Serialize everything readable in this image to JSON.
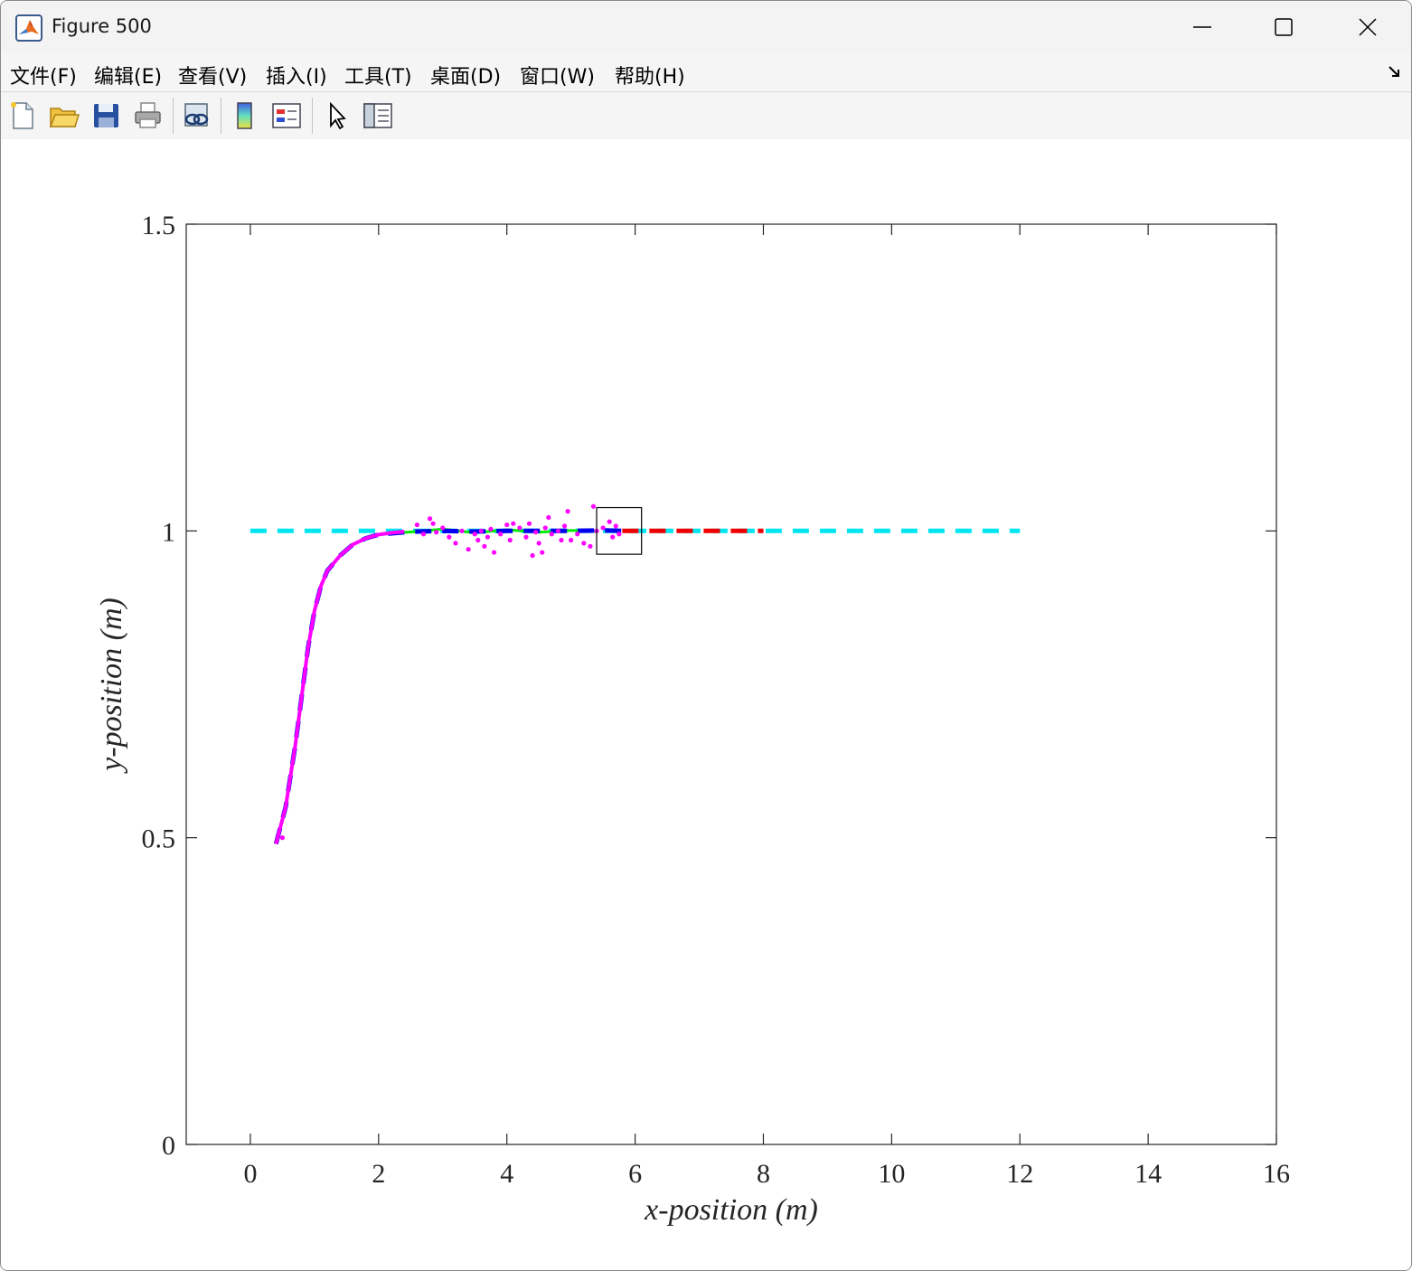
{
  "window": {
    "title": "Figure 500",
    "controls": {
      "minimize": "minimize",
      "maximize": "maximize",
      "close": "close"
    }
  },
  "menu": {
    "items": [
      {
        "label": "文件(F)",
        "id": "file"
      },
      {
        "label": "编辑(E)",
        "id": "edit"
      },
      {
        "label": "查看(V)",
        "id": "view"
      },
      {
        "label": "插入(I)",
        "id": "insert"
      },
      {
        "label": "工具(T)",
        "id": "tools"
      },
      {
        "label": "桌面(D)",
        "id": "desktop"
      },
      {
        "label": "窗口(W)",
        "id": "window"
      },
      {
        "label": "帮助(H)",
        "id": "help"
      }
    ]
  },
  "toolbar": {
    "buttons": [
      "new-figure-icon",
      "open-file-icon",
      "save-icon",
      "print-icon",
      "link-plot-icon",
      "colorbar-icon",
      "legend-icon",
      "edit-plot-arrow-icon",
      "property-inspector-icon"
    ]
  },
  "chart_data": {
    "type": "line",
    "title": "",
    "xlabel": "x-position (m)",
    "ylabel": "y-position (m)",
    "xlim": [
      -1,
      16
    ],
    "ylim": [
      0,
      1.5
    ],
    "xticks": [
      "0",
      "2",
      "4",
      "6",
      "8",
      "10",
      "12",
      "14",
      "16"
    ],
    "yticks": [
      "0",
      "0.5",
      "1",
      "1.5"
    ],
    "grid": false,
    "legend": "none",
    "series": [
      {
        "style": "dashed",
        "color": "#00e5f0",
        "x": [
          0,
          12
        ],
        "y": [
          1,
          1
        ]
      },
      {
        "style": "solid",
        "color": "#00ee00",
        "x": [
          0.4,
          0.55,
          0.7,
          0.8,
          0.9,
          1.0,
          1.1,
          1.2,
          1.4,
          1.6,
          1.8,
          2.0,
          2.3,
          2.6,
          3.0,
          3.5,
          4.0,
          4.5,
          5.0,
          5.4
        ],
        "y": [
          0.49,
          0.55,
          0.65,
          0.73,
          0.81,
          0.87,
          0.91,
          0.935,
          0.96,
          0.978,
          0.988,
          0.994,
          0.997,
          0.999,
          1.003,
          0.997,
          1.002,
          0.998,
          1.001,
          0.999
        ]
      },
      {
        "style": "dashed",
        "color": "#0000ee",
        "x": [
          0.4,
          0.55,
          0.7,
          0.8,
          0.9,
          1.0,
          1.1,
          1.2,
          1.4,
          1.6,
          1.8,
          2.0,
          2.3,
          2.6,
          3.0,
          3.5,
          4.0,
          4.5,
          5.0,
          5.5,
          5.8
        ],
        "y": [
          0.49,
          0.55,
          0.65,
          0.73,
          0.81,
          0.87,
          0.91,
          0.935,
          0.96,
          0.978,
          0.988,
          0.994,
          0.997,
          0.999,
          1.0,
          0.999,
          1.0,
          1.0,
          1.0,
          1.001,
          1.0
        ]
      },
      {
        "style": "dashed",
        "color": "#ee0000",
        "x": [
          5.8,
          8.0
        ],
        "y": [
          1,
          1
        ]
      },
      {
        "style": "solid",
        "color": "#ff00ff",
        "x": [
          0.4,
          0.55,
          0.7,
          0.8,
          0.9,
          1.0,
          1.1,
          1.2,
          1.4,
          1.6,
          1.8,
          2.0,
          2.2,
          2.4
        ],
        "y": [
          0.49,
          0.55,
          0.65,
          0.73,
          0.81,
          0.87,
          0.91,
          0.935,
          0.96,
          0.978,
          0.988,
          0.994,
          0.997,
          0.999
        ]
      },
      {
        "style": "markers",
        "color": "#ff00ff",
        "x": [
          0.5,
          2.6,
          2.7,
          2.8,
          2.85,
          2.9,
          3.0,
          3.1,
          3.2,
          3.3,
          3.4,
          3.5,
          3.55,
          3.6,
          3.65,
          3.7,
          3.75,
          3.8,
          3.9,
          4.0,
          4.05,
          4.1,
          4.2,
          4.3,
          4.35,
          4.4,
          4.45,
          4.5,
          4.55,
          4.6,
          4.65,
          4.7,
          4.8,
          4.85,
          4.9,
          4.95,
          5.0,
          5.1,
          5.2,
          5.3,
          5.35,
          5.4,
          5.5,
          5.6,
          5.65,
          5.7,
          5.75
        ],
        "y": [
          0.5,
          1.01,
          0.995,
          1.02,
          1.012,
          0.998,
          1.005,
          0.99,
          0.98,
          1.0,
          0.97,
          0.995,
          0.985,
          1.0,
          0.975,
          0.99,
          1.003,
          0.965,
          0.995,
          1.01,
          0.985,
          1.012,
          1.005,
          0.99,
          1.012,
          0.96,
          0.998,
          0.98,
          0.965,
          1.005,
          1.022,
          0.995,
          1.0,
          0.985,
          1.008,
          1.032,
          0.985,
          0.995,
          0.98,
          0.975,
          1.04,
          1.0,
          1.005,
          1.015,
          0.99,
          1.008,
          0.995
        ]
      }
    ],
    "annotations": [
      {
        "type": "rectangle",
        "x": [
          5.4,
          6.1
        ],
        "y": [
          0.962,
          1.038
        ]
      }
    ]
  }
}
